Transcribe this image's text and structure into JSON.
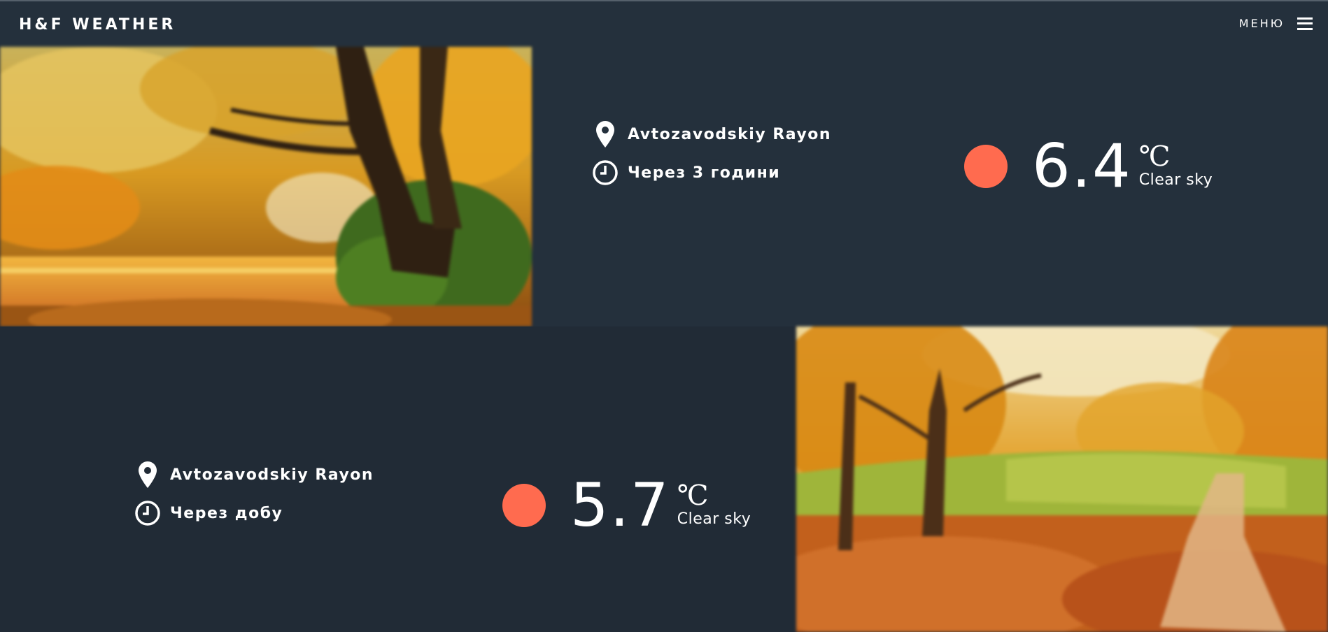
{
  "header": {
    "brand": "H&F WEATHER",
    "menu_label": "МЕНЮ",
    "menu_icon": "hamburger-icon"
  },
  "forecasts": [
    {
      "location": "Avtozavodskiy Rayon",
      "time_label": "Через 3 години",
      "temperature": "6.4",
      "unit": "℃",
      "condition": "Clear sky",
      "indicator_color": "#ff6b4f",
      "location_icon": "map-pin-icon",
      "time_icon": "clock-icon",
      "image": "autumn-lake-trees-photo"
    },
    {
      "location": "Avtozavodskiy Rayon",
      "time_label": "Через добу",
      "temperature": "5.7",
      "unit": "℃",
      "condition": "Clear sky",
      "indicator_color": "#ff6b4f",
      "location_icon": "map-pin-icon",
      "time_icon": "clock-icon",
      "image": "autumn-park-path-photo"
    }
  ],
  "colors": {
    "background": "#222d38",
    "header": "#24303c",
    "accent": "#ff6b4f"
  }
}
